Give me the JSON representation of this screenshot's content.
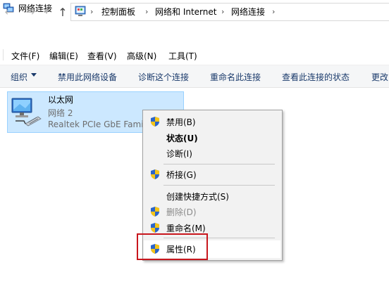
{
  "window": {
    "title": "网络连接"
  },
  "address": {
    "crumbs": [
      "控制面板",
      "网络和 Internet",
      "网络连接"
    ]
  },
  "menu": [
    "文件(F)",
    "编辑(E)",
    "查看(V)",
    "高级(N)",
    "工具(T)"
  ],
  "commands": {
    "organize": "组织",
    "disable_device": "禁用此网络设备",
    "diagnose": "诊断这个连接",
    "rename": "重命名此连接",
    "view_status": "查看此连接的状态",
    "change": "更改"
  },
  "adapter": {
    "name": "以太网",
    "status": "网络 2",
    "device": "Realtek PCIe GbE Family Controller"
  },
  "context_menu": {
    "disable": "禁用(B)",
    "status": "状态(U)",
    "diagnose": "诊断(I)",
    "bridge": "桥接(G)",
    "shortcut": "创建快捷方式(S)",
    "delete": "删除(D)",
    "rename": "重命名(M)",
    "properties": "属性(R)"
  },
  "colors": {
    "selection": "#cce8ff",
    "highlight_box": "#c8161d",
    "command_text": "#1a3a6b"
  }
}
